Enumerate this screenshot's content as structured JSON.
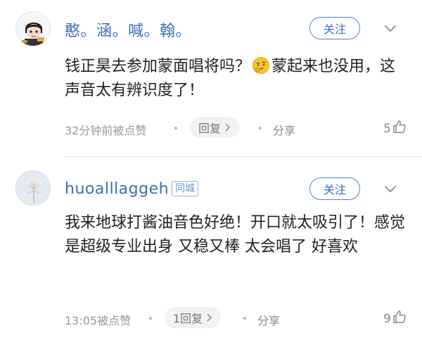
{
  "comments": [
    {
      "username": "憨。涵。喊。翰。",
      "follow_label": "关注",
      "content_before_emoji": "钱正昊去参加蒙面唱将吗？",
      "emoji": "thinking-face-emoji",
      "content_after_emoji": "蒙起来也没用，这声音太有辨识度了！",
      "time_text": "32分钟前被点赞",
      "reply_label": "回复",
      "share_label": "分享",
      "like_count": "5"
    },
    {
      "username": "huoalllaggeh",
      "badge": "同城",
      "follow_label": "关注",
      "content": "我来地球打酱油音色好绝！开口就太吸引了！感觉是超级专业出身 又稳又棒 太会唱了 好喜欢",
      "time_text": "13:05被点赞",
      "reply_label": "1回复",
      "share_label": "分享",
      "like_count": "9"
    }
  ],
  "colors": {
    "username": "#3b6fb6",
    "follow_border": "#4a84cc",
    "meta": "#999999",
    "reply_bg": "#f2f2f2"
  }
}
